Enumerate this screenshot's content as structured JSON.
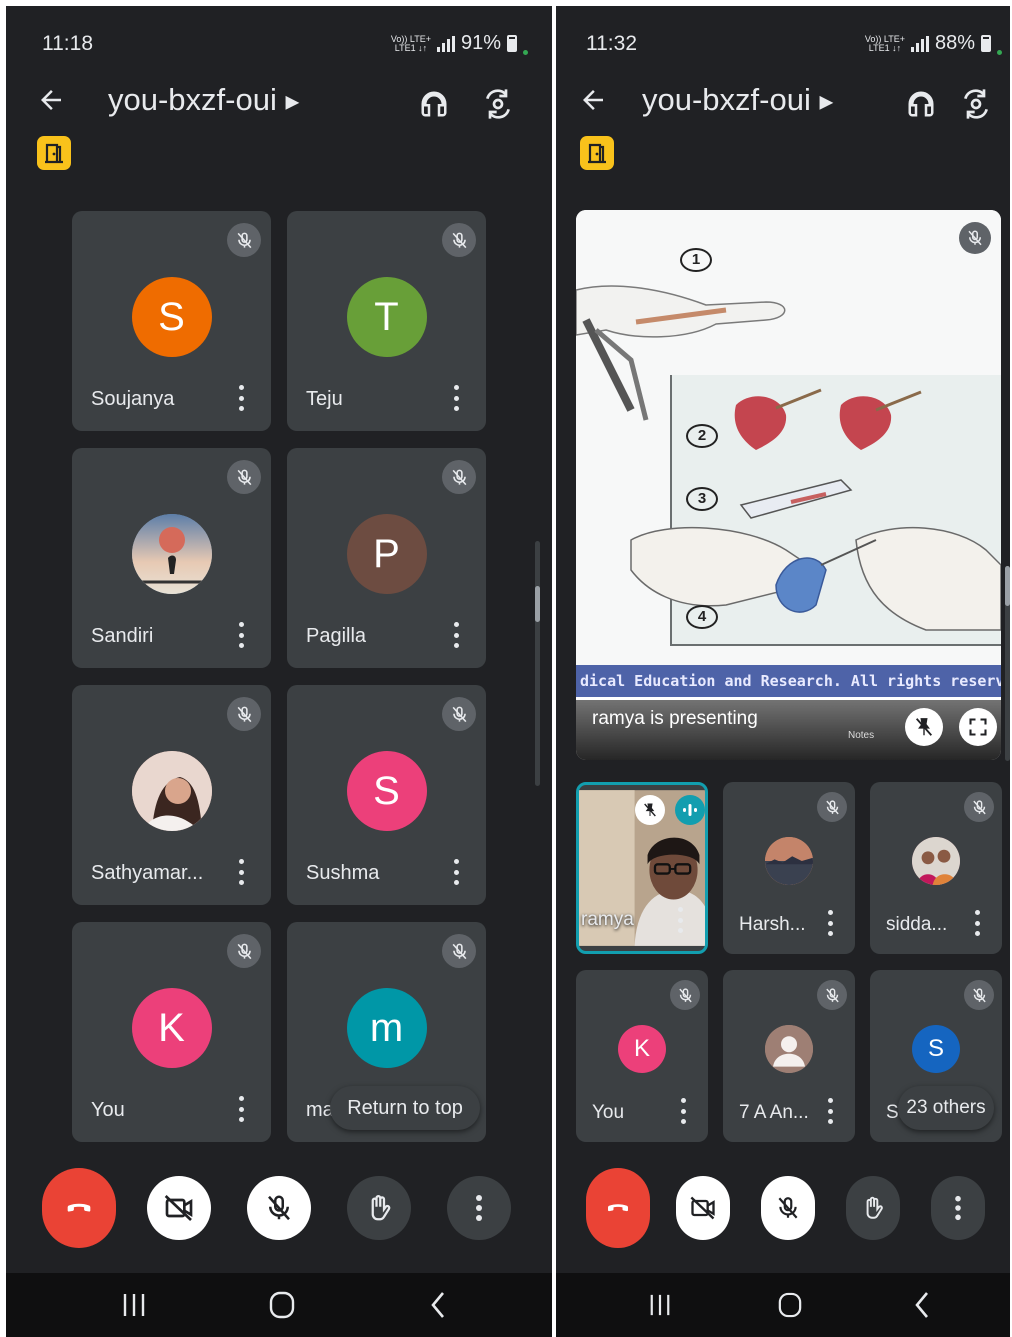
{
  "left": {
    "status": {
      "time": "11:18",
      "network": "Vo)) LTE+ LTE1 ↓↑",
      "battery": "91%"
    },
    "meeting_code": "you-bxzf-oui",
    "participants": [
      {
        "initial": "S",
        "name": "Soujanya",
        "color": "#ef6c00"
      },
      {
        "initial": "T",
        "name": "Teju",
        "color": "#689f38"
      },
      {
        "initial": "",
        "name": "Sandiri",
        "color": "#6a8fb0"
      },
      {
        "initial": "P",
        "name": "Pagilla",
        "color": "#6d4c41"
      },
      {
        "initial": "",
        "name": "Sathyamar...",
        "color": "#c48b83"
      },
      {
        "initial": "S",
        "name": "Sushma",
        "color": "#ec407a"
      },
      {
        "initial": "K",
        "name": "You",
        "color": "#ec407a"
      },
      {
        "initial": "m",
        "name": "ma",
        "color": "#0097a7"
      }
    ],
    "return_to_top": "Return to top"
  },
  "right": {
    "status": {
      "time": "11:32",
      "network": "Vo)) LTE+ LTE1 ↓↑",
      "battery": "88%"
    },
    "meeting_code": "you-bxzf-oui",
    "slide": {
      "steps": [
        "1",
        "2",
        "3",
        "4"
      ],
      "footer": "dical Education and Research. All rights reserve"
    },
    "presenting_text": "ramya is presenting",
    "notes_label": "Notes",
    "participants": [
      {
        "initial": "",
        "name": "ramya",
        "color": "#8a7a70"
      },
      {
        "initial": "",
        "name": "Harsh...",
        "color": "#c88a6a"
      },
      {
        "initial": "",
        "name": "sidda...",
        "color": "#b06070"
      },
      {
        "initial": "K",
        "name": "You",
        "color": "#ec407a"
      },
      {
        "initial": "",
        "name": "7 A An...",
        "color": "#9e7f74"
      },
      {
        "initial": "S",
        "name": "Sa",
        "color": "#1565c0"
      }
    ],
    "others_label": "23 others"
  },
  "colors": {
    "end_call": "#ea4335",
    "tile": "#3c4043",
    "background": "#202124",
    "badge": "#f9c21b",
    "active_speaker": "#129eaf"
  },
  "icons": [
    "arrow-back-icon",
    "headphones-icon",
    "switch-camera-icon",
    "door-icon",
    "mic-off-icon",
    "more-vert-icon",
    "call-end-icon",
    "video-off-icon",
    "raise-hand-icon",
    "pin-off-icon",
    "fullscreen-icon",
    "recents-icon",
    "home-icon",
    "nav-back-icon"
  ]
}
